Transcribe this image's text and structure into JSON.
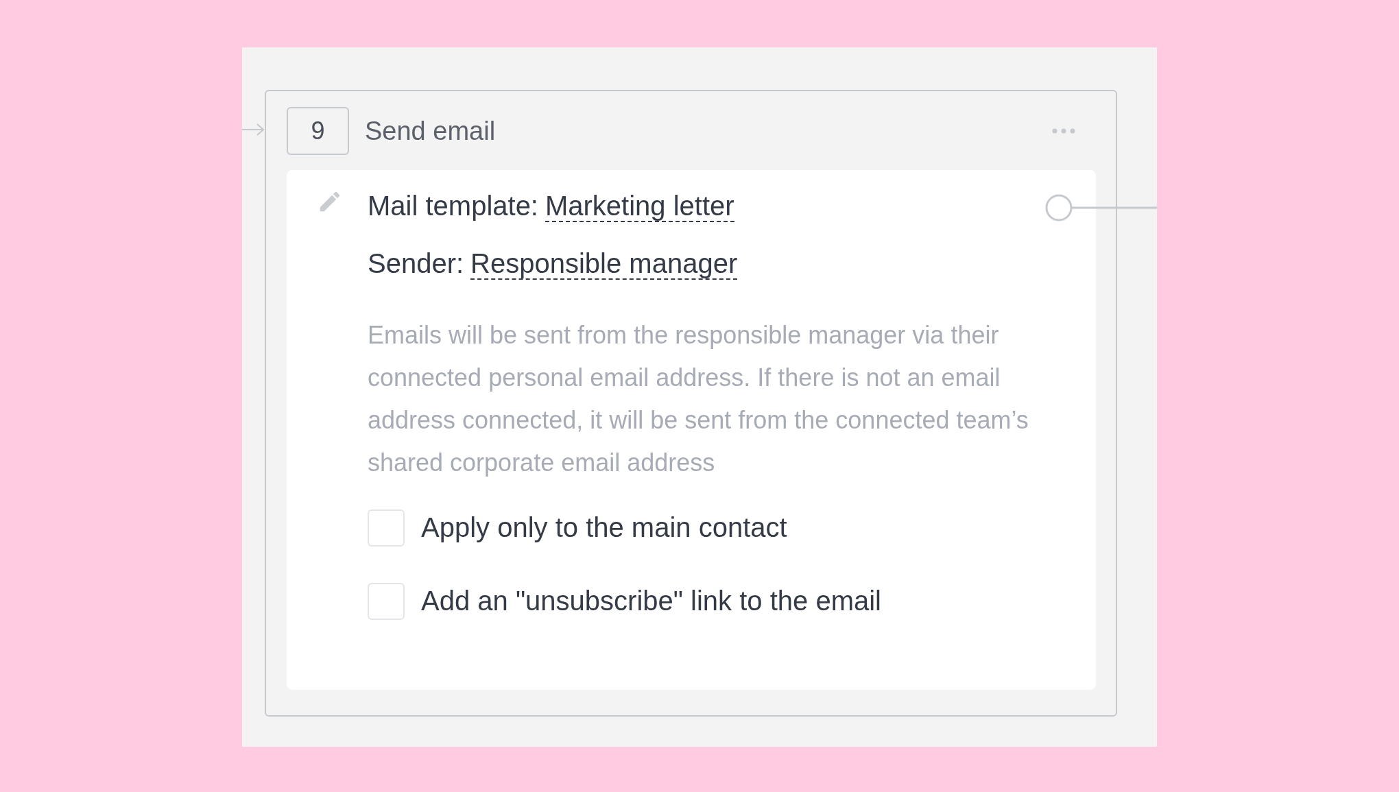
{
  "step": {
    "number": "9",
    "title": "Send email"
  },
  "fields": [
    {
      "label": "Mail template:",
      "value": "Marketing letter"
    },
    {
      "label": "Sender:",
      "value": "Responsible manager"
    }
  ],
  "description": "Emails will be sent from the responsible manager via their connected personal email address. If there is not an email address connected, it will be sent from the connected team’s shared corporate email address",
  "options": [
    {
      "label": "Apply only to the main contact",
      "checked": false
    },
    {
      "label": "Add an \"unsubscribe\" link to the email",
      "checked": false
    }
  ]
}
